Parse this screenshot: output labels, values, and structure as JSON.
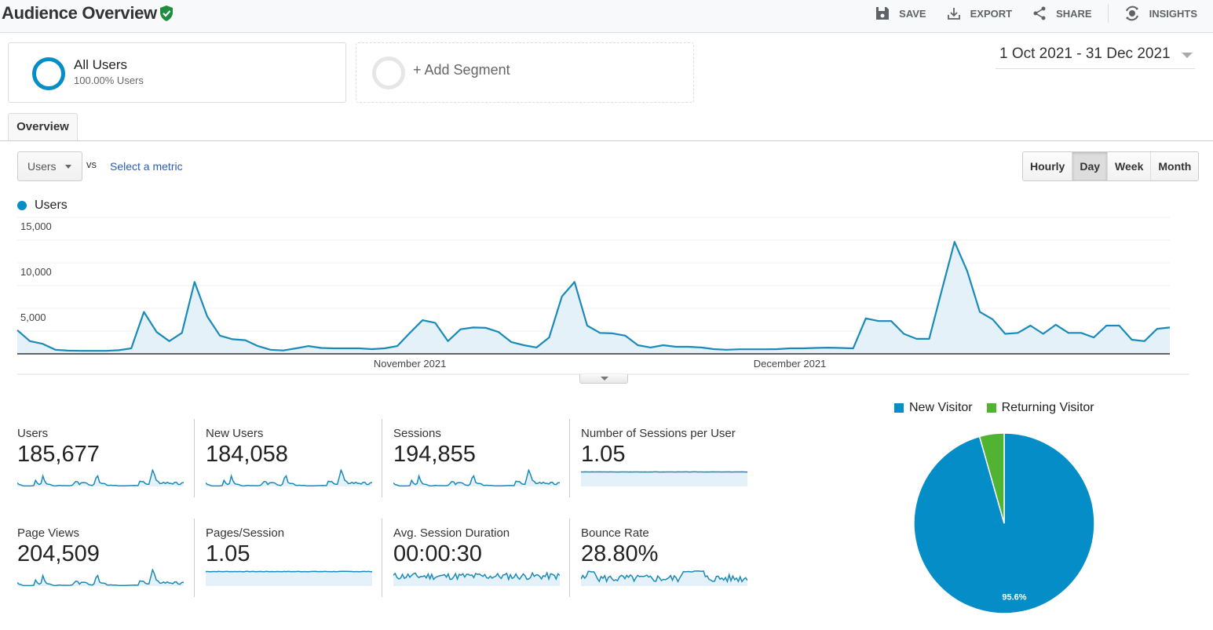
{
  "header": {
    "title": "Audience Overview",
    "verified_icon": "shield-check-icon",
    "actions": [
      {
        "label": "SAVE",
        "icon": "save-icon"
      },
      {
        "label": "EXPORT",
        "icon": "download-icon"
      },
      {
        "label": "SHARE",
        "icon": "share-icon"
      },
      {
        "label": "INSIGHTS",
        "icon": "insights-icon"
      }
    ]
  },
  "segments": {
    "all": {
      "name": "All Users",
      "sub": "100.00% Users"
    },
    "add_label": "+ Add Segment"
  },
  "date_range": "1 Oct 2021 - 31 Dec 2021",
  "tabs": [
    {
      "label": "Overview",
      "active": true
    }
  ],
  "controls": {
    "metric": "Users",
    "vs": "vs",
    "select_metric": "Select a metric",
    "granularity": [
      {
        "label": "Hourly",
        "active": false
      },
      {
        "label": "Day",
        "active": true
      },
      {
        "label": "Week",
        "active": false
      },
      {
        "label": "Month",
        "active": false
      }
    ]
  },
  "colors": {
    "primary": "#058dc7",
    "line": "#1a8ab9",
    "fill": "#e5f1f8",
    "returning": "#50b432"
  },
  "chart_data": [
    {
      "type": "area",
      "title": "",
      "legend": [
        "Users"
      ],
      "legend_position": "top-left",
      "x_start": "2021-10-01",
      "x_end": "2021-12-31",
      "x_tick_labels": [
        {
          "label": "November 2021",
          "index": 31
        },
        {
          "label": "December 2021",
          "index": 61
        }
      ],
      "y_tick_labels": [
        "5,000",
        "10,000",
        "15,000"
      ],
      "y_ticks": [
        5000,
        10000,
        15000
      ],
      "ylim": [
        0,
        15000
      ],
      "grid": true,
      "series": [
        {
          "name": "Users",
          "values": [
            2600,
            1400,
            1100,
            450,
            350,
            330,
            330,
            330,
            400,
            600,
            4600,
            2400,
            1400,
            2300,
            7900,
            4100,
            2000,
            1600,
            1500,
            850,
            450,
            370,
            600,
            850,
            650,
            600,
            600,
            600,
            520,
            600,
            850,
            2300,
            3700,
            3400,
            1400,
            2700,
            2900,
            2850,
            2400,
            1300,
            950,
            700,
            1800,
            6300,
            7900,
            3100,
            2300,
            2250,
            2000,
            950,
            700,
            950,
            780,
            780,
            700,
            520,
            450,
            500,
            500,
            500,
            520,
            600,
            600,
            650,
            680,
            650,
            600,
            3900,
            3600,
            3600,
            2200,
            1650,
            1650,
            7000,
            12300,
            9100,
            4600,
            3800,
            2200,
            2300,
            3100,
            2200,
            3200,
            2300,
            2300,
            1800,
            3100,
            3100,
            1550,
            1400,
            2750,
            2900
          ]
        }
      ]
    },
    {
      "type": "pie",
      "legend": [
        "New Visitor",
        "Returning Visitor"
      ],
      "legend_position": "top",
      "slices": [
        {
          "label": "New Visitor",
          "value": 95.6,
          "color": "#058dc7",
          "data_label": "95.6%"
        },
        {
          "label": "Returning Visitor",
          "value": 4.4,
          "color": "#50b432"
        }
      ]
    }
  ],
  "metrics": [
    {
      "label": "Users",
      "value": "185,677",
      "spark": "users"
    },
    {
      "label": "New Users",
      "value": "184,058",
      "spark": "users"
    },
    {
      "label": "Sessions",
      "value": "194,855",
      "spark": "users"
    },
    {
      "label": "Number of Sessions per User",
      "value": "1.05",
      "spark": "flat"
    },
    {
      "label": "Page Views",
      "value": "204,509",
      "spark": "users"
    },
    {
      "label": "Pages/Session",
      "value": "1.05",
      "spark": "flat2"
    },
    {
      "label": "Avg. Session Duration",
      "value": "00:00:30",
      "spark": "duration"
    },
    {
      "label": "Bounce Rate",
      "value": "28.80%",
      "spark": "bounce"
    }
  ]
}
